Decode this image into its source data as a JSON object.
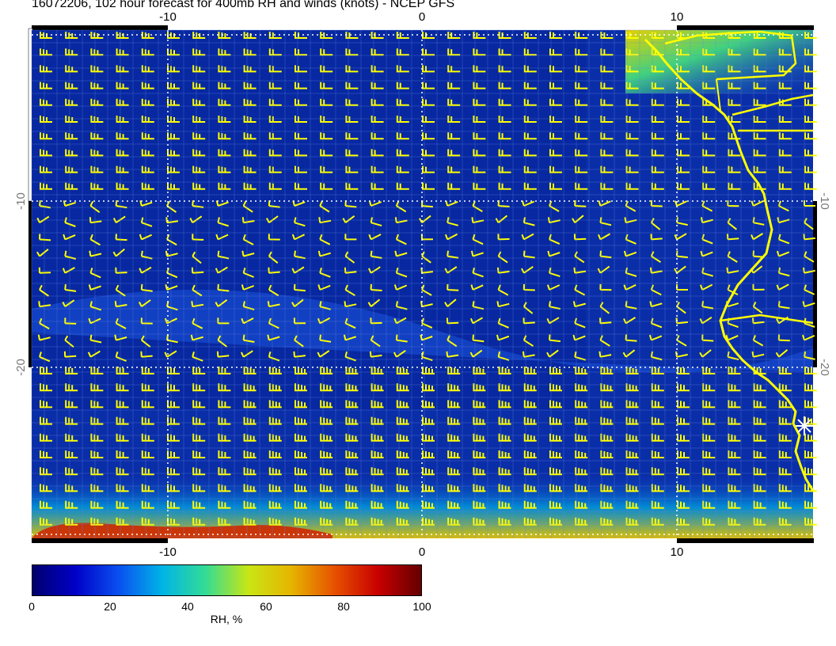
{
  "title": "16072206, 102 hour forecast for 400mb RH and winds (knots) - NCEP GFS",
  "map": {
    "lon_range": [
      -16,
      15
    ],
    "lat_range": [
      -30,
      -10
    ],
    "lon_ticks": [
      "-10",
      "0",
      "10"
    ],
    "lat_ticks": [
      "-10",
      "-20"
    ],
    "grid_lines": "dotted",
    "background_fill": "#0a2ea8",
    "coastline_color": "#ffff00",
    "barb_color": "#ffff00",
    "marker": "star-asterisk"
  },
  "colorbar": {
    "label": "RH, %",
    "ticks": [
      "0",
      "20",
      "40",
      "60",
      "80",
      "100"
    ],
    "colors": [
      "#00006e",
      "#0000c8",
      "#0a50f0",
      "#00b4e6",
      "#32dc96",
      "#c8e614",
      "#e6b400",
      "#e65000",
      "#c80000",
      "#640000"
    ]
  }
}
